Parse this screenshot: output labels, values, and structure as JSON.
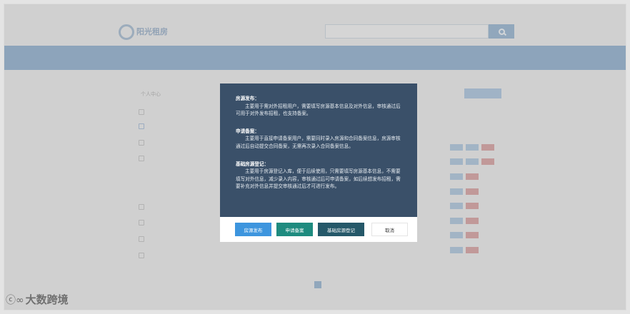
{
  "modal": {
    "sections": [
      {
        "title": "房源发布：",
        "text": "主要用于需对外招租用户，需要填写房源基本信息及对外信息，审核通过后可用于对外发布招租，也支持备案。"
      },
      {
        "title": "申请备案：",
        "text": "主要用于直接申请备案用户，需要同时录入房源和合同备案信息，房源审核通过后自动提交合同备案，无需再次录入合同备案信息。"
      },
      {
        "title": "基础房源登记：",
        "text": "主要用于房源登记入库，便于后续使用，只需要填写房源基本信息，不需要填写对外信息，减少录入内容，审核通过后可申请备案，如后续想发布招租，需要补充对外信息并提交审核通过后才可进行发布。"
      }
    ],
    "buttons": {
      "publish": "房源发布",
      "apply": "申请备案",
      "basic": "基础房源登记",
      "cancel": "取消"
    }
  },
  "colors": {
    "modal_bg": "#3a5069",
    "publish_btn": "#3d95de",
    "apply_btn": "#1e8b7f",
    "basic_btn": "#255869",
    "nav_bar": "#8aaccd",
    "overlay": "#969696"
  },
  "background": {
    "logo_title": "阳光租房",
    "sidebar_title": "个人中心",
    "icons": [
      "search-icon",
      "home-logo-icon",
      "user-icon",
      "house-icon"
    ]
  },
  "watermark": {
    "mark": "ⓒ∞",
    "text": "大数跨境"
  }
}
